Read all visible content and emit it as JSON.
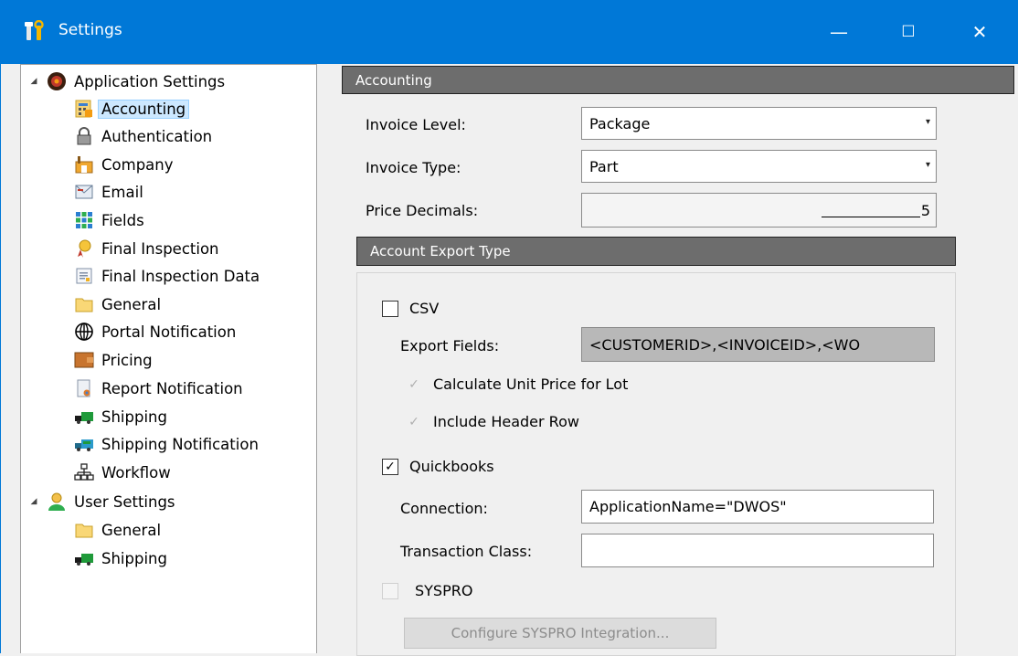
{
  "window": {
    "title": "Settings",
    "minimize_glyph": "—",
    "maximize_glyph": "☐",
    "close_glyph": "✕",
    "accent": "#0078d7"
  },
  "tree": {
    "app_settings_label": "Application Settings",
    "app_items": [
      {
        "label": "Accounting",
        "icon": "accounting-icon",
        "selected": true
      },
      {
        "label": "Authentication",
        "icon": "lock-icon"
      },
      {
        "label": "Company",
        "icon": "factory-icon"
      },
      {
        "label": "Email",
        "icon": "email-icon"
      },
      {
        "label": "Fields",
        "icon": "grid-icon"
      },
      {
        "label": "Final Inspection",
        "icon": "ribbon-icon"
      },
      {
        "label": "Final Inspection Data",
        "icon": "document-icon"
      },
      {
        "label": "General",
        "icon": "folder-icon"
      },
      {
        "label": "Portal Notification",
        "icon": "globe-icon"
      },
      {
        "label": "Pricing",
        "icon": "wallet-icon"
      },
      {
        "label": "Report Notification",
        "icon": "report-icon"
      },
      {
        "label": "Shipping",
        "icon": "truck-icon"
      },
      {
        "label": "Shipping Notification",
        "icon": "truck-notification-icon"
      },
      {
        "label": "Workflow",
        "icon": "workflow-icon"
      }
    ],
    "user_settings_label": "User Settings",
    "user_items": [
      {
        "label": "General",
        "icon": "folder-icon"
      },
      {
        "label": "Shipping",
        "icon": "truck-icon"
      }
    ]
  },
  "accounting": {
    "header": "Accounting",
    "invoice_level_label": "Invoice Level:",
    "invoice_level_value": "Package",
    "invoice_type_label": "Invoice Type:",
    "invoice_type_value": "Part",
    "price_decimals_label": "Price Decimals:",
    "price_decimals_value": "5",
    "combo_arrow": "▾"
  },
  "export": {
    "header": "Account Export Type",
    "csv_label": "CSV",
    "csv_checked": false,
    "export_fields_label": "Export Fields:",
    "export_fields_value": "<CUSTOMERID>,<INVOICEID>,<WO",
    "calc_unit_price_label": "Calculate Unit Price for Lot",
    "calc_unit_price_checked": true,
    "include_header_label": "Include Header Row",
    "include_header_checked": true,
    "quickbooks_label": "Quickbooks",
    "quickbooks_checked": true,
    "connection_label": "Connection:",
    "connection_value": "ApplicationName=\"DWOS\"",
    "transaction_class_label": "Transaction Class:",
    "transaction_class_value": "",
    "syspro_label": "SYSPRO",
    "syspro_checked": false,
    "configure_syspro_label": "Configure SYSPRO Integration...",
    "check_glyph": "✓"
  }
}
